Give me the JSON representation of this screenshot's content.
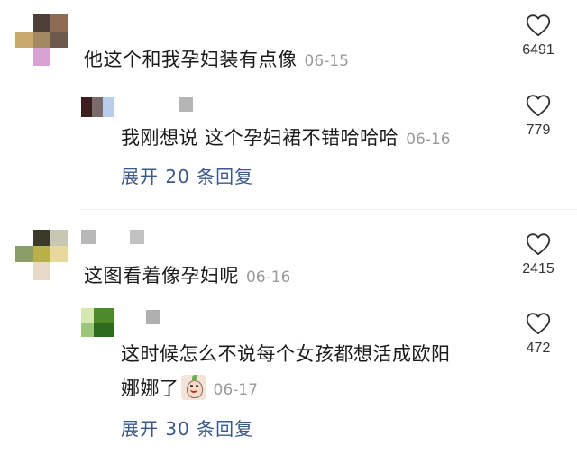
{
  "comments": [
    {
      "text": "他这个和我孕妇装有点像",
      "date": "06-15",
      "likes": "6491",
      "avatar_icon": "blurred-avatar",
      "reply": {
        "text": "我刚想说 这个孕妇裙不错哈哈哈",
        "date": "06-16",
        "likes": "779",
        "avatar_icon": "blurred-avatar"
      },
      "expand_label": "展开 20 条回复"
    },
    {
      "text": "这图看着像孕妇呢",
      "date": "06-16",
      "likes": "2415",
      "avatar_icon": "blurred-avatar",
      "reply": {
        "text_line1": "这时候怎么不说每个女孩都想活成欧阳",
        "text_line2": "娜娜了",
        "sticker_icon": "cute-face-sticker",
        "date": "06-17",
        "likes": "472",
        "avatar_icon": "blurred-avatar"
      },
      "expand_label": "展开 30 条回复"
    }
  ],
  "icons": {
    "like": "heart-outline-icon"
  },
  "colors": {
    "link": "#3a5a8a",
    "date": "#9a9a9a",
    "text": "#1a1a1a"
  }
}
